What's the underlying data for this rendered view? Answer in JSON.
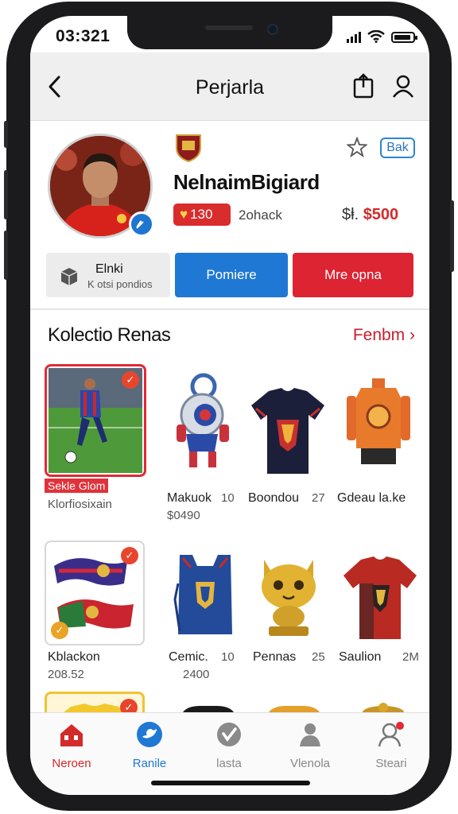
{
  "status": {
    "time": "03:321"
  },
  "navbar": {
    "title": "Perjarla"
  },
  "profile": {
    "name": "NelnaimBigiard",
    "bak_label": "Bak",
    "likes": "130",
    "sub_text": "2ohack",
    "price_currency": "$ⱡ.",
    "price_amount": "$500"
  },
  "actions": {
    "info_line1": "Elnki",
    "info_line2": "K otsi pondios",
    "blue_button": "Pomiere",
    "red_button": "Mre opna"
  },
  "collection": {
    "title": "Kolectio Renas",
    "more_link": "Fenbm",
    "items": [
      {
        "name": "Sekle Glom",
        "sub": "Klorfiosixain",
        "icon": "player-photo-card"
      },
      {
        "name": "Makuok",
        "count": "10",
        "price": "$0490",
        "icon": "robot-mascot-figure"
      },
      {
        "name": "Boondou",
        "count": "27",
        "icon": "navy-jersey"
      },
      {
        "name": "Gdeau la.ke",
        "icon": "orange-kit"
      },
      {
        "name": "Kblackon",
        "sub": "208.52",
        "icon": "scarf-pack"
      },
      {
        "name": "Cemic.",
        "count": "10",
        "price": "2400",
        "icon": "blue-vest"
      },
      {
        "name": "Pennas",
        "count": "25",
        "icon": "gold-cat-figure"
      },
      {
        "name": "Saulion",
        "count": "2M",
        "icon": "red-jersey"
      }
    ]
  },
  "tabs": [
    {
      "label": "Neroen",
      "icon": "home-icon",
      "state": "active"
    },
    {
      "label": "Ranile",
      "icon": "bird-icon",
      "state": "blue"
    },
    {
      "label": "lasta",
      "icon": "check-shield-icon",
      "state": ""
    },
    {
      "label": "Vlenola",
      "icon": "person-group-icon",
      "state": ""
    },
    {
      "label": "Steari",
      "icon": "profile-icon",
      "state": ""
    }
  ],
  "colors": {
    "accent_red": "#dc2433",
    "accent_blue": "#1f78d4",
    "price_red": "#d42a2a"
  }
}
